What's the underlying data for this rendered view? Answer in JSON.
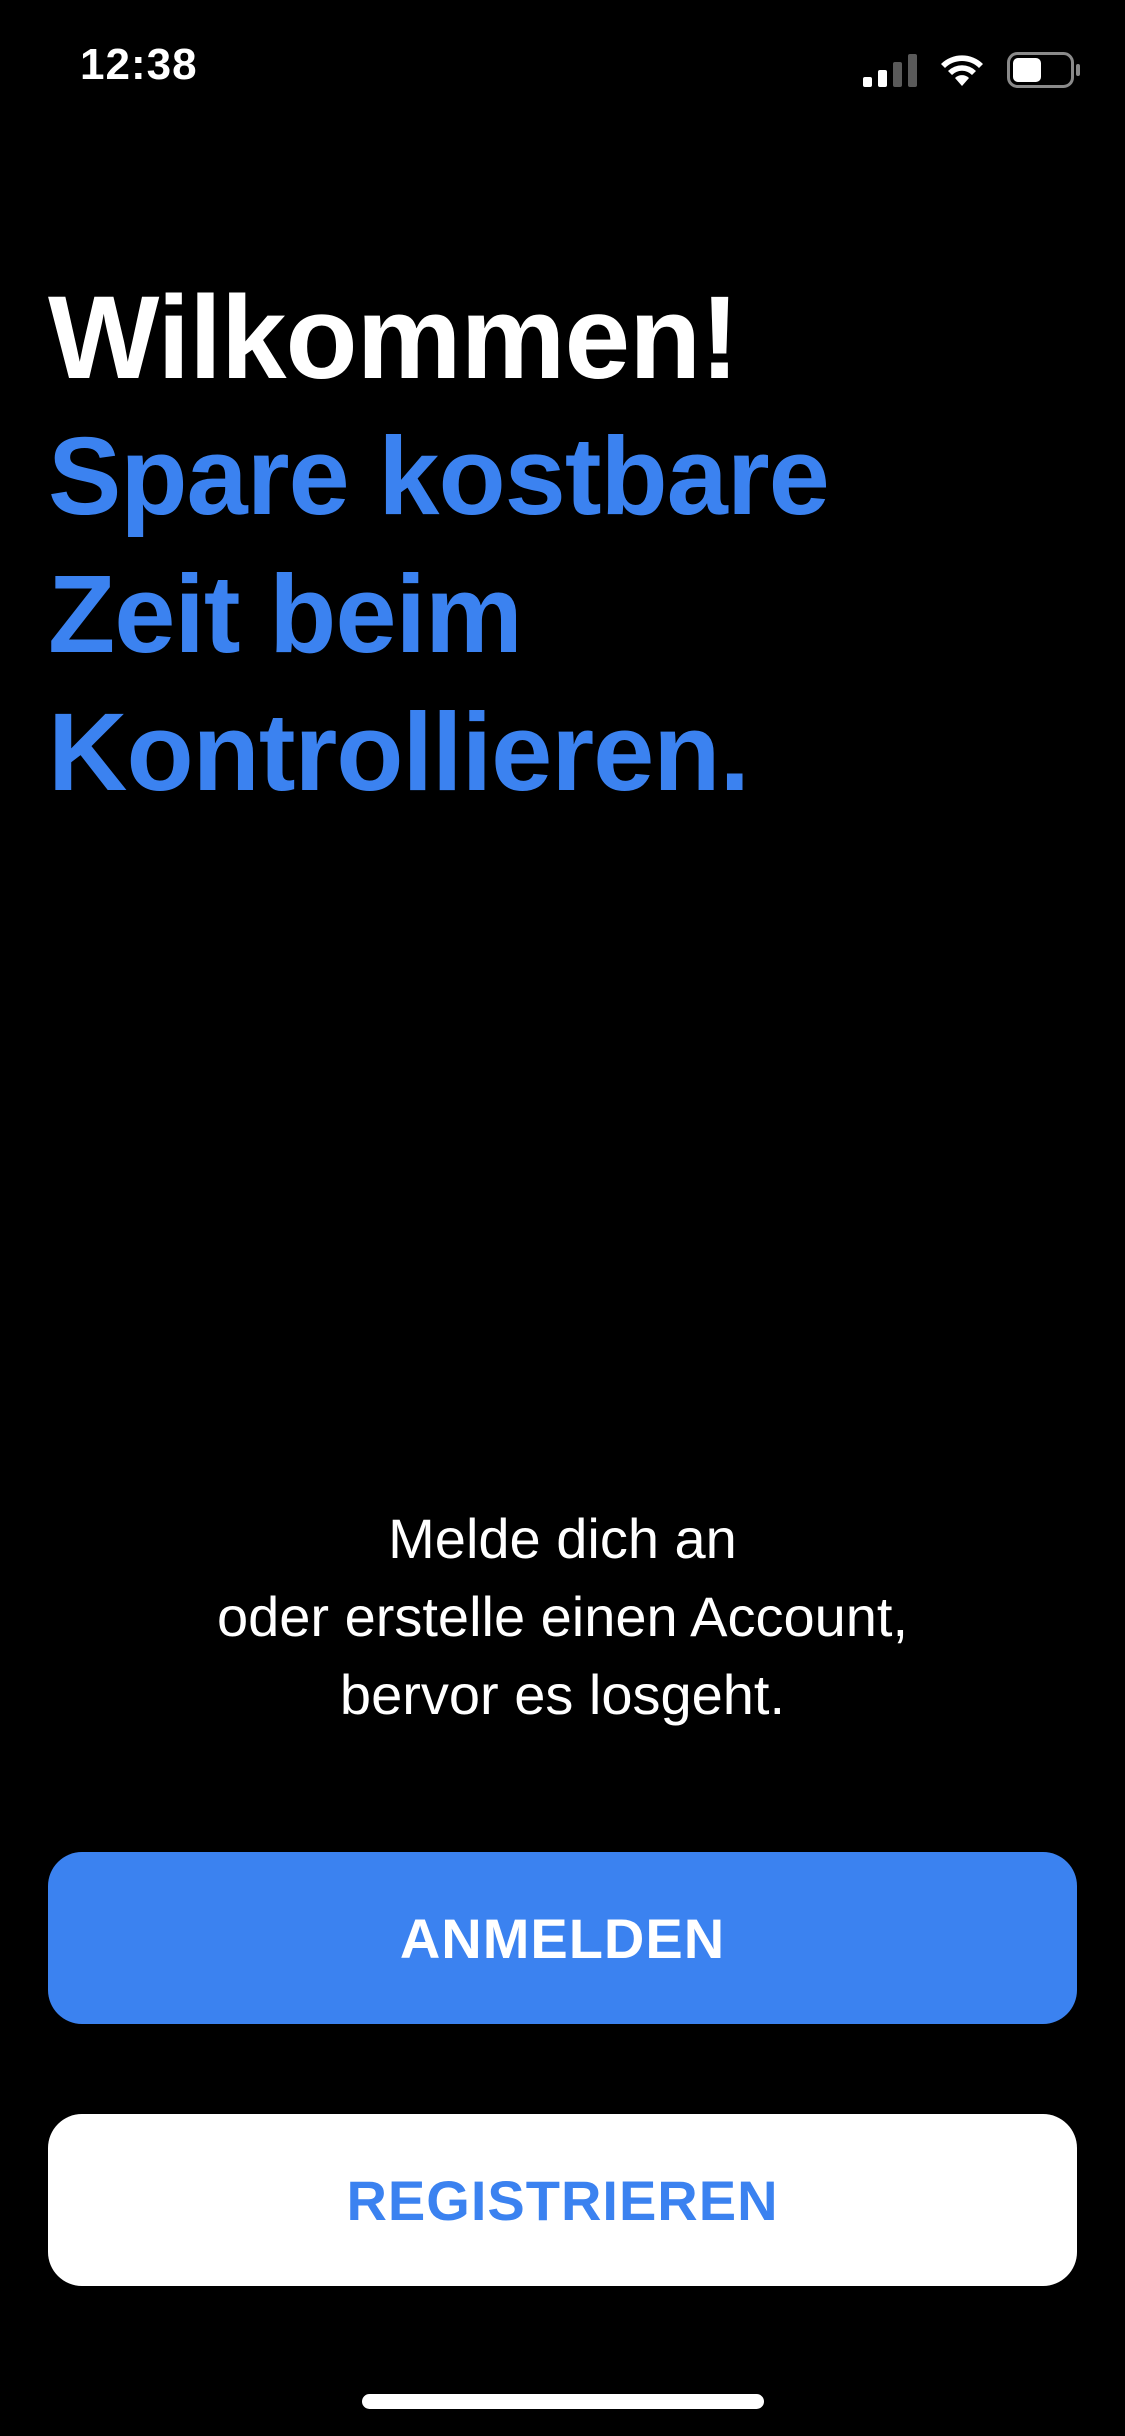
{
  "status_bar": {
    "time": "12:38",
    "signal_icon": "cellular-signal-icon",
    "wifi_icon": "wifi-icon",
    "battery_icon": "battery-icon",
    "battery_level": 0.5
  },
  "headline": {
    "welcome": "Wilkommen!",
    "tagline_lines": [
      "Spare kostbare",
      "Zeit beim",
      "Kontrollieren."
    ]
  },
  "info": {
    "lines": [
      "Melde dich an",
      "oder erstelle einen Account,",
      "bervor es losgeht."
    ]
  },
  "buttons": {
    "login_label": "ANMELDEN",
    "register_label": "REGISTRIEREN"
  },
  "colors": {
    "accent": "#3b82f0",
    "background": "#000000",
    "text": "#ffffff"
  }
}
